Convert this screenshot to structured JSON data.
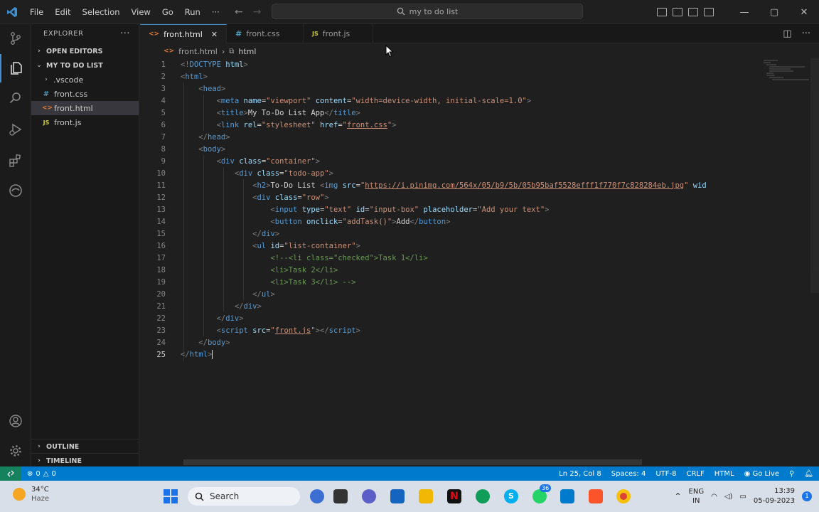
{
  "titlebar": {
    "menu": [
      "File",
      "Edit",
      "Selection",
      "View",
      "Go",
      "Run",
      "···"
    ],
    "search": "my to do list"
  },
  "sidebar": {
    "header": "EXPLORER",
    "open_editors": "OPEN EDITORS",
    "folder": "MY TO DO LIST",
    "files": [
      {
        "name": ".vscode",
        "icon": "chevron-right"
      },
      {
        "name": "front.css",
        "icon": "#"
      },
      {
        "name": "front.html",
        "icon": "<>"
      },
      {
        "name": "front.js",
        "icon": "JS"
      }
    ],
    "outline": "OUTLINE",
    "timeline": "TIMELINE"
  },
  "tabs": [
    {
      "label": "front.html",
      "icon": "<>",
      "close": "✕"
    },
    {
      "label": "front.css",
      "icon": "#"
    },
    {
      "label": "front.js",
      "icon": "JS"
    }
  ],
  "breadcrumb": {
    "file": "front.html",
    "element": "html"
  },
  "code": {
    "line_numbers": [
      "1",
      "2",
      "3",
      "4",
      "5",
      "6",
      "7",
      "8",
      "9",
      "10",
      "11",
      "12",
      "13",
      "14",
      "15",
      "16",
      "17",
      "18",
      "19",
      "20",
      "21",
      "22",
      "23",
      "24",
      "25"
    ]
  },
  "statusbar": {
    "problems": "0",
    "warnings": "0",
    "position": "Ln 25, Col 8",
    "spaces": "Spaces: 4",
    "encoding": "UTF-8",
    "eol": "CRLF",
    "language": "HTML",
    "golive": "Go Live"
  },
  "taskbar": {
    "temp": "34°C",
    "weather": "Haze",
    "search": "Search",
    "lang1": "ENG",
    "lang2": "IN",
    "time": "13:39",
    "date": "05-09-2023",
    "badge": "36",
    "notif": "1"
  },
  "colors": {
    "accent": "#007acc",
    "remote": "#16825d",
    "tag": "#569cd6",
    "attr": "#9cdcfe",
    "string": "#ce9178",
    "comment": "#6a9955"
  }
}
